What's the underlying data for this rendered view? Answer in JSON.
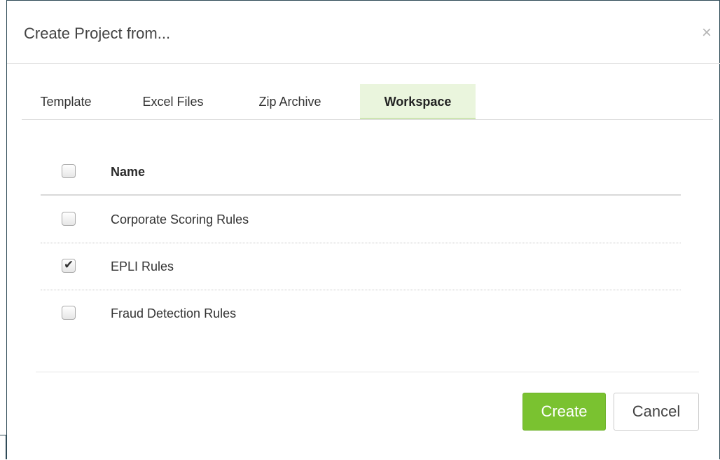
{
  "dialog": {
    "title": "Create Project from...",
    "close_glyph": "×",
    "close_icon": "close-icon"
  },
  "tabs": [
    {
      "label": "Template",
      "active": false
    },
    {
      "label": "Excel Files",
      "active": false
    },
    {
      "label": "Zip Archive",
      "active": false
    },
    {
      "label": "Workspace",
      "active": true
    }
  ],
  "table": {
    "header": {
      "label": "Name",
      "checked": false
    },
    "rows": [
      {
        "label": "Corporate Scoring Rules",
        "checked": false
      },
      {
        "label": "EPLI Rules",
        "checked": true
      },
      {
        "label": "Fraud Detection Rules",
        "checked": false
      }
    ],
    "check_glyph": "✔"
  },
  "footer": {
    "create_label": "Create",
    "cancel_label": "Cancel"
  },
  "colors": {
    "accent": "#7ac230",
    "active_tab_bg": "#eaf5dd",
    "frame_border": "#2f4b57"
  }
}
